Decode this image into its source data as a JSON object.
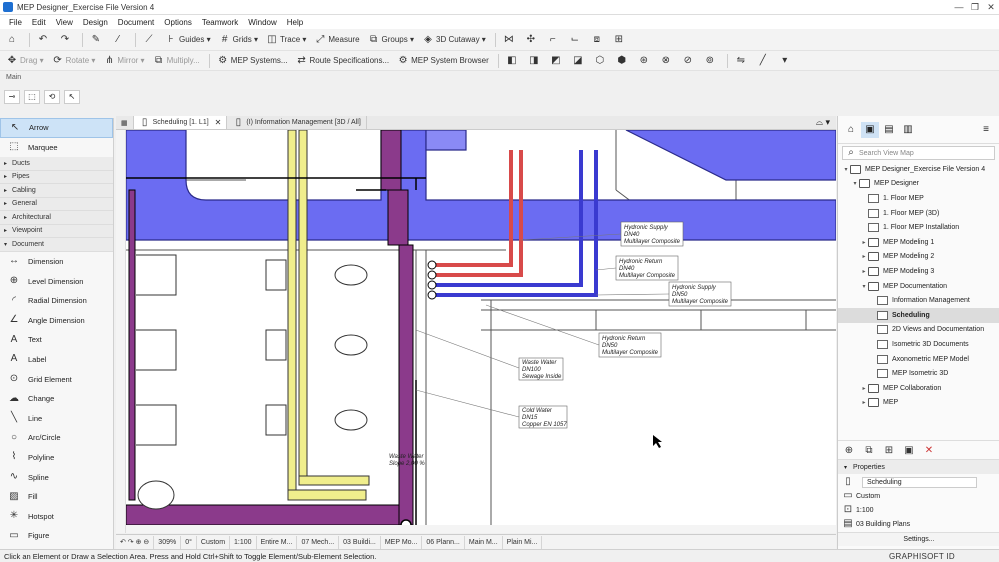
{
  "window": {
    "title": "MEP Designer_Exercise File Version 4",
    "controls": [
      "—",
      "❐",
      "✕"
    ]
  },
  "menu": [
    "File",
    "Edit",
    "View",
    "Design",
    "Document",
    "Options",
    "Teamwork",
    "Window",
    "Help"
  ],
  "toolbar1": {
    "guides": "Guides",
    "grids": "Grids",
    "trace": "Trace",
    "measure": "Measure",
    "groups": "Groups",
    "cutaway": "3D Cutaway"
  },
  "toolbar2": {
    "drag": "Drag",
    "rotate": "Rotate",
    "mirror": "Mirror",
    "multiply": "Multiply...",
    "mep_systems": "MEP Systems...",
    "route_specs": "Route Specifications...",
    "mep_browser": "MEP System Browser"
  },
  "main_label": "Main",
  "toolbox": {
    "top_tools": [
      {
        "label": "Arrow",
        "icon": "arrow-icon",
        "glyph": "↖"
      },
      {
        "label": "Marquee",
        "icon": "marquee-icon",
        "glyph": "⬚"
      }
    ],
    "groups": [
      "Ducts",
      "Pipes",
      "Cabling",
      "General",
      "Architectural",
      "Viewpoint",
      "Document"
    ],
    "document_tools": [
      {
        "label": "Dimension",
        "icon": "dimension-icon",
        "glyph": "↔"
      },
      {
        "label": "Level Dimension",
        "icon": "level-dimension-icon",
        "glyph": "⊕"
      },
      {
        "label": "Radial Dimension",
        "icon": "radial-dimension-icon",
        "glyph": "◜"
      },
      {
        "label": "Angle Dimension",
        "icon": "angle-dimension-icon",
        "glyph": "∠"
      },
      {
        "label": "Text",
        "icon": "text-icon",
        "glyph": "A"
      },
      {
        "label": "Label",
        "icon": "label-icon",
        "glyph": "A"
      },
      {
        "label": "Grid Element",
        "icon": "grid-element-icon",
        "glyph": "⊙"
      },
      {
        "label": "Change",
        "icon": "change-icon",
        "glyph": "☁"
      },
      {
        "label": "Line",
        "icon": "line-icon",
        "glyph": "╲"
      },
      {
        "label": "Arc/Circle",
        "icon": "arc-circle-icon",
        "glyph": "○"
      },
      {
        "label": "Polyline",
        "icon": "polyline-icon",
        "glyph": "⌇"
      },
      {
        "label": "Spline",
        "icon": "spline-icon",
        "glyph": "∿"
      },
      {
        "label": "Fill",
        "icon": "fill-icon",
        "glyph": "▨"
      },
      {
        "label": "Hotspot",
        "icon": "hotspot-icon",
        "glyph": "✳"
      },
      {
        "label": "Figure",
        "icon": "figure-icon",
        "glyph": "▭"
      }
    ]
  },
  "tabs": [
    {
      "label": "Scheduling [1. L1]",
      "active": true
    },
    {
      "label": "(I) Information Management [3D / All]",
      "active": false
    }
  ],
  "drawing_labels": [
    {
      "line1": "Hydronic Supply",
      "line2": "DN40",
      "line3": "Multilayer Composite"
    },
    {
      "line1": "Hydronic Return",
      "line2": "DN40",
      "line3": "Multilayer Composite"
    },
    {
      "line1": "Hydronic Supply",
      "line2": "DN50",
      "line3": "Multilayer Composite"
    },
    {
      "line1": "Hydronic Return",
      "line2": "DN50",
      "line3": "Multilayer Composite"
    },
    {
      "line1": "Waste Water",
      "line2": "DN100",
      "line3": "Sewage Inside"
    },
    {
      "line1": "Cold Water",
      "line2": "DN15",
      "line3": "Copper EN 1057"
    },
    {
      "line1": "Waste Water",
      "line2": "Slope 2,00 %",
      "line3": ""
    }
  ],
  "viewbar": [
    "309%",
    "0°",
    "Custom",
    "1:100",
    "Entire M...",
    "07 Mech...",
    "03 Buildi...",
    "MEP Mo...",
    "06 Plann...",
    "Main M...",
    "Plain Mi..."
  ],
  "navigator": {
    "search_placeholder": "Search View Map",
    "items": [
      {
        "label": "MEP Designer_Exercise File Version 4",
        "indent": 0,
        "tw": "▾",
        "folder": true
      },
      {
        "label": "MEP Designer",
        "indent": 1,
        "tw": "▾",
        "folder": true
      },
      {
        "label": "1. Floor MEP",
        "indent": 2,
        "tw": "",
        "folder": false
      },
      {
        "label": "1. Floor MEP (3D)",
        "indent": 2,
        "tw": "",
        "folder": false
      },
      {
        "label": "1. Floor MEP Installation",
        "indent": 2,
        "tw": "",
        "folder": false
      },
      {
        "label": "MEP Modeling 1",
        "indent": 2,
        "tw": "▸",
        "folder": true
      },
      {
        "label": "MEP Modeling 2",
        "indent": 2,
        "tw": "▸",
        "folder": true
      },
      {
        "label": "MEP Modeling 3",
        "indent": 2,
        "tw": "▸",
        "folder": true
      },
      {
        "label": "MEP Documentation",
        "indent": 2,
        "tw": "▾",
        "folder": true
      },
      {
        "label": "Information Management",
        "indent": 3,
        "tw": "",
        "folder": false
      },
      {
        "label": "Scheduling",
        "indent": 3,
        "tw": "",
        "folder": false,
        "selected": true
      },
      {
        "label": "2D Views and Documentation",
        "indent": 3,
        "tw": "",
        "folder": false
      },
      {
        "label": "Isometric 3D Documents",
        "indent": 3,
        "tw": "",
        "folder": false
      },
      {
        "label": "Axonometric MEP Model",
        "indent": 3,
        "tw": "",
        "folder": false
      },
      {
        "label": "MEP Isometric 3D",
        "indent": 3,
        "tw": "",
        "folder": false
      },
      {
        "label": "MEP Collaboration",
        "indent": 2,
        "tw": "▸",
        "folder": true
      },
      {
        "label": "MEP",
        "indent": 2,
        "tw": "▸",
        "folder": true
      }
    ]
  },
  "properties": {
    "header": "Properties",
    "name": "Scheduling",
    "rows": [
      "Custom",
      "1:100",
      "03 Building Plans"
    ],
    "settings": "Settings..."
  },
  "status": "Click an Element or Draw a Selection Area. Press and Hold Ctrl+Shift to Toggle Element/Sub-Element Selection.",
  "brand": "GRAPHISOFT ID",
  "colors": {
    "duct": "#6b6cf2",
    "hydronic_supply": "#d84a4a",
    "hydronic_return": "#3a3ad0",
    "waste": "#8b3a8b",
    "cold_water": "#f0ee8c"
  }
}
